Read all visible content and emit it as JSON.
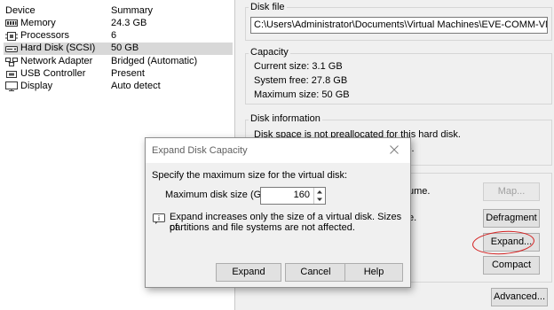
{
  "devices": {
    "header_device": "Device",
    "header_summary": "Summary",
    "items": [
      {
        "name": "Memory",
        "summary": "24.3 GB",
        "icon": "memory-icon"
      },
      {
        "name": "Processors",
        "summary": "6",
        "icon": "processor-icon"
      },
      {
        "name": "Hard Disk (SCSI)",
        "summary": "50 GB",
        "icon": "hard-disk-icon"
      },
      {
        "name": "Network Adapter",
        "summary": "Bridged (Automatic)",
        "icon": "network-adapter-icon"
      },
      {
        "name": "USB Controller",
        "summary": "Present",
        "icon": "usb-controller-icon"
      },
      {
        "name": "Display",
        "summary": "Auto detect",
        "icon": "display-icon"
      }
    ]
  },
  "disk_file": {
    "title": "Disk file",
    "path": "C:\\Users\\Administrator\\Documents\\Virtual Machines\\EVE-COMM-VM For SDW"
  },
  "capacity": {
    "title": "Capacity",
    "current": "Current size: 3.1 GB",
    "system_free": "System free: 27.8 GB",
    "maximum": "Maximum size: 50 GB"
  },
  "disk_info": {
    "title": "Disk information",
    "line1": "Disk space is not preallocated for this hard disk.",
    "line2_partial": "le."
  },
  "utilities": {
    "text1_partial": "ume.",
    "text2_partial": "e.",
    "map_label": "Map...",
    "defrag_label": "Defragment",
    "expand_label": "Expand...",
    "compact_label": "Compact"
  },
  "advanced_label": "Advanced...",
  "dialog": {
    "title": "Expand Disk Capacity",
    "prompt": "Specify the maximum size for the virtual disk:",
    "field_label": "Maximum disk size (GB):",
    "field_value": "160",
    "info_line1": "Expand increases only the size of a virtual disk. Sizes of",
    "info_line2": "partitions and file systems are not affected.",
    "expand_button": "Expand",
    "cancel_button": "Cancel",
    "help_button": "Help"
  },
  "colors": {
    "selection": "#d8d8d8",
    "annotation_circle": "#d42020"
  }
}
